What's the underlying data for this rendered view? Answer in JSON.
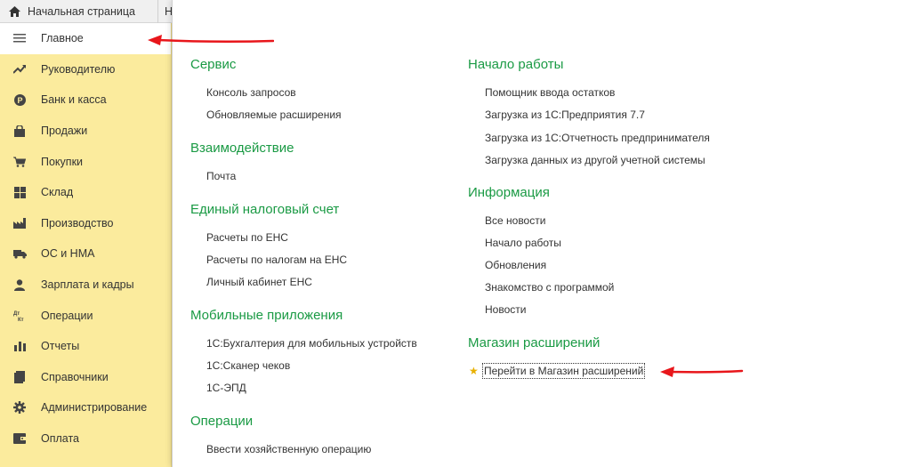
{
  "topbar": {
    "home_tab": "Начальная страница",
    "next_tab": "Н"
  },
  "sidebar": {
    "items": [
      {
        "label": "Главное",
        "icon": "hamburger-icon",
        "active": true
      },
      {
        "label": "Руководителю",
        "icon": "trend-up-icon"
      },
      {
        "label": "Банк и касса",
        "icon": "coin-icon"
      },
      {
        "label": "Продажи",
        "icon": "shopping-bag-icon"
      },
      {
        "label": "Покупки",
        "icon": "cart-icon"
      },
      {
        "label": "Склад",
        "icon": "grid-icon"
      },
      {
        "label": "Производство",
        "icon": "factory-icon"
      },
      {
        "label": "ОС и НМА",
        "icon": "truck-icon"
      },
      {
        "label": "Зарплата и кадры",
        "icon": "person-icon"
      },
      {
        "label": "Операции",
        "icon": "dt-kt-icon"
      },
      {
        "label": "Отчеты",
        "icon": "bar-chart-icon"
      },
      {
        "label": "Справочники",
        "icon": "book-icon"
      },
      {
        "label": "Администрирование",
        "icon": "gear-icon"
      },
      {
        "label": "Оплата",
        "icon": "wallet-icon"
      }
    ]
  },
  "left_col": {
    "service": {
      "title": "Сервис",
      "links": [
        "Консоль запросов",
        "Обновляемые расширения"
      ]
    },
    "interaction": {
      "title": "Взаимодействие",
      "links": [
        "Почта"
      ]
    },
    "ens": {
      "title": "Единый налоговый счет",
      "links": [
        "Расчеты по ЕНС",
        "Расчеты по налогам на ЕНС",
        "Личный кабинет ЕНС"
      ]
    },
    "mobile": {
      "title": "Мобильные приложения",
      "links": [
        "1С:Бухгалтерия для мобильных устройств",
        "1С:Сканер чеков",
        "1С-ЭПД"
      ]
    },
    "operations": {
      "title": "Операции",
      "links": [
        "Ввести хозяйственную операцию"
      ]
    }
  },
  "right_col": {
    "start": {
      "title": "Начало работы",
      "links": [
        "Помощник ввода остатков",
        "Загрузка из 1С:Предприятия 7.7",
        "Загрузка из 1С:Отчетность предпринимателя",
        "Загрузка данных из другой учетной системы"
      ]
    },
    "info": {
      "title": "Информация",
      "links": [
        "Все новости",
        "Начало работы",
        "Обновления",
        "Знакомство с программой",
        "Новости"
      ]
    },
    "store": {
      "title": "Магазин расширений",
      "links": [
        "Перейти в Магазин расширений"
      ]
    }
  },
  "colors": {
    "sidebar_bg": "#fbeb9d",
    "section_title": "#1a9a44",
    "arrow": "#e8161b",
    "star": "#e8b000"
  }
}
